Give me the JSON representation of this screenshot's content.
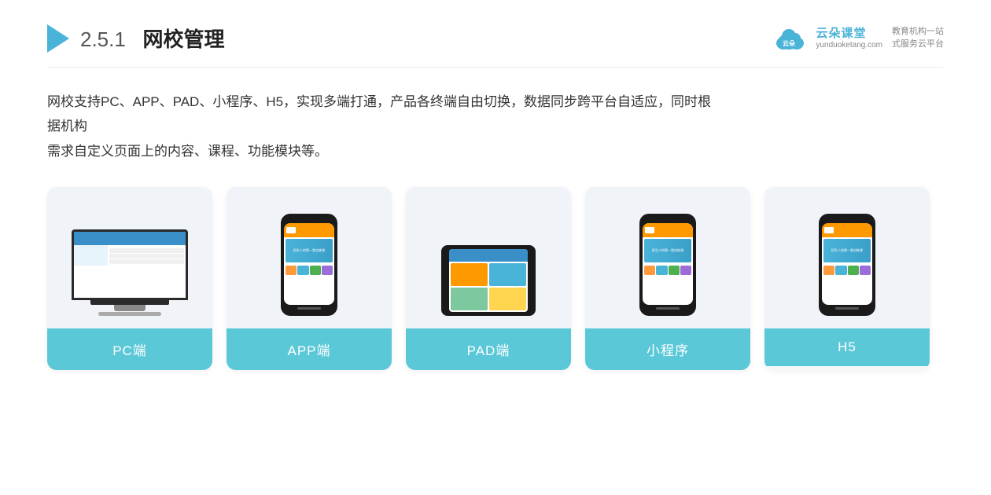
{
  "header": {
    "section_num": "2.5.1",
    "title_bold": "网校管理",
    "brand": {
      "name": "云朵课堂",
      "url": "yunduoketang.com",
      "slogan_line1": "教育机构一站",
      "slogan_line2": "式服务云平台"
    }
  },
  "description": {
    "text_line1": "网校支持PC、APP、PAD、小程序、H5，实现多端打通，产品各终端自由切换，数据同步跨平台自适应，同时根据机构",
    "text_line2": "需求自定义页面上的内容、课程、功能模块等。"
  },
  "cards": [
    {
      "id": "pc",
      "label": "PC端",
      "type": "pc"
    },
    {
      "id": "app",
      "label": "APP端",
      "type": "phone"
    },
    {
      "id": "pad",
      "label": "PAD端",
      "type": "pad"
    },
    {
      "id": "miniprogram",
      "label": "小程序",
      "type": "phone"
    },
    {
      "id": "h5",
      "label": "H5",
      "type": "phone"
    }
  ]
}
